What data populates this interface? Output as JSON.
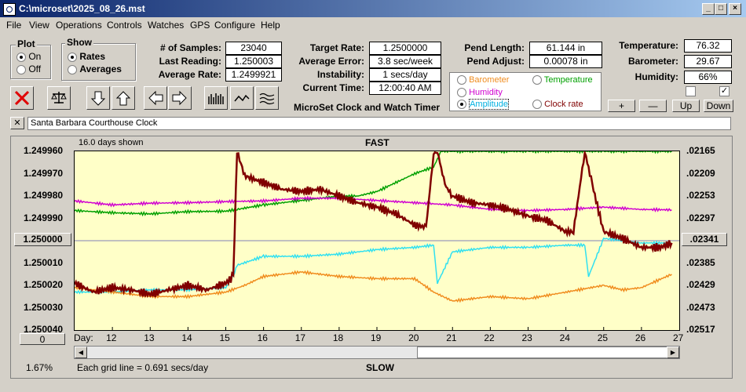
{
  "window": {
    "title": "C:\\microset\\2025_08_26.mst"
  },
  "menu": [
    "File",
    "View",
    "Operations",
    "Controls",
    "Watches",
    "GPS",
    "Configure",
    "Help"
  ],
  "plot_group": {
    "label": "Plot",
    "options": [
      "On",
      "Off"
    ],
    "selected": "On"
  },
  "show_group": {
    "label": "Show",
    "options": [
      "Rates",
      "Averages"
    ],
    "selected": "Rates"
  },
  "stats": {
    "samples_label": "# of Samples:",
    "samples": "23040",
    "last_label": "Last Reading:",
    "last": "1.250003",
    "avg_label": "Average Rate:",
    "avg": "1.2499921"
  },
  "rates": {
    "target_label": "Target Rate:",
    "target": "1.2500000",
    "error_label": "Average Error:",
    "error": "3.8 sec/week",
    "instab_label": "Instability:",
    "instab": "1 secs/day",
    "time_label": "Current Time:",
    "time": "12:00:40 AM"
  },
  "pend": {
    "length_label": "Pend Length:",
    "length": "61.144 in",
    "adjust_label": "Pend Adjust:",
    "adjust": "0.00078 in"
  },
  "sensor_options": {
    "items": [
      {
        "label": "Barometer",
        "color": "#f08c1e",
        "selected": false
      },
      {
        "label": "Temperature",
        "color": "#00a000",
        "selected": false
      },
      {
        "label": "Humidity",
        "color": "#d000d0",
        "selected": false
      },
      {
        "label": "Clock rate",
        "color": "#800000",
        "selected": false
      },
      {
        "label": "Amplitude",
        "color": "#00b0e0",
        "selected": true
      }
    ]
  },
  "env": {
    "temp_label": "Temperature:",
    "temp": "76.32",
    "baro_label": "Barometer:",
    "baro": "29.67",
    "hum_label": "Humidity:",
    "hum": "66%"
  },
  "scale_buttons": {
    "plus": "+",
    "minus": "—",
    "up": "Up",
    "down": "Down"
  },
  "app_caption": "MicroSet Clock and Watch Timer",
  "clock_name": "Santa Barbara Courthouse Clock",
  "close_x": "✕",
  "colors": {
    "rate": "#800000",
    "temperature": "#00a000",
    "humidity": "#d000d0",
    "amplitude": "#30e0f0",
    "barometer": "#f08c1e",
    "plot_bg": "#ffffc8"
  },
  "chart_data": {
    "type": "line",
    "title": "FAST",
    "bottom_label": "SLOW",
    "days_shown": "16.0 days shown",
    "grid_note": "Each grid line = 0.691 secs/day",
    "scroll_percent": "1.67%",
    "center_value": "1.250000",
    "right_center_value": ".02341",
    "left_button": "0",
    "x_prefix": "Day:",
    "x_ticks": [
      "12",
      "13",
      "14",
      "15",
      "16",
      "17",
      "18",
      "19",
      "20",
      "21",
      "22",
      "23",
      "24",
      "25",
      "26",
      "27"
    ],
    "xlim": [
      11,
      27
    ],
    "y_left_ticks": [
      "1.249960",
      "1.249970",
      "1.249980",
      "1.249990",
      "1.250000",
      "1.250010",
      "1.250020",
      "1.250030",
      "1.250040"
    ],
    "y_right_ticks": [
      ".02165",
      ".02209",
      ".02253",
      ".02297",
      ".02341",
      ".02385",
      ".02429",
      ".02473",
      ".02517"
    ],
    "ylim_left": [
      1.24996,
      1.25004
    ],
    "series": [
      {
        "key": "temperature",
        "x": [
          11,
          12,
          13,
          14,
          15,
          15.3,
          16,
          17,
          18,
          18.5,
          19,
          19.5,
          20,
          20.5,
          20.7,
          21,
          22,
          23,
          24,
          25,
          26,
          26.8
        ],
        "y": [
          1.2499865,
          1.2499875,
          1.249988,
          1.249987,
          1.2499868,
          1.249986,
          1.249984,
          1.249982,
          1.24998,
          1.24998,
          1.249978,
          1.249974,
          1.24997,
          1.249967,
          1.24996,
          1.24996,
          1.24996,
          1.24996,
          1.24996,
          1.24996,
          1.24996,
          1.24996
        ]
      },
      {
        "key": "humidity",
        "x": [
          11,
          12,
          13,
          14,
          15,
          16,
          17,
          18,
          19,
          20,
          21,
          22,
          23,
          24,
          25,
          26,
          26.8
        ],
        "y": [
          1.2499822,
          1.249984,
          1.2499832,
          1.249983,
          1.2499825,
          1.2499822,
          1.249981,
          1.249981,
          1.249982,
          1.249983,
          1.249984,
          1.249986,
          1.2499865,
          1.249986,
          1.249985,
          1.249986,
          1.2499862
        ]
      },
      {
        "key": "amplitude",
        "x": [
          11,
          12,
          13,
          14,
          15,
          15.2,
          15.3,
          16,
          17,
          18,
          19,
          20,
          20.5,
          20.6,
          21,
          22,
          23,
          24,
          24.5,
          24.6,
          25,
          26,
          26.8
        ],
        "y": [
          1.250023,
          1.250023,
          1.250022,
          1.250022,
          1.250021,
          1.250016,
          1.250011,
          1.250007,
          1.250007,
          1.250006,
          1.250004,
          1.250003,
          1.250002,
          1.250019,
          1.250005,
          1.250003,
          1.250003,
          1.250002,
          1.250002,
          1.250016,
          1.249999,
          1.250001,
          1.250001
        ]
      },
      {
        "key": "barometer",
        "x": [
          11,
          12,
          13,
          14,
          15,
          15.5,
          16,
          17,
          18,
          19,
          20,
          20.5,
          21,
          22,
          23,
          24,
          25,
          25.5,
          26,
          26.8
        ],
        "y": [
          1.250021,
          1.250023,
          1.250025,
          1.250025,
          1.250023,
          1.25002,
          1.250016,
          1.250014,
          1.250016,
          1.250017,
          1.250017,
          1.250023,
          1.250027,
          1.250025,
          1.250026,
          1.250023,
          1.25002,
          1.250022,
          1.250021,
          1.250015
        ]
      },
      {
        "key": "rate",
        "x": [
          11,
          11.5,
          12,
          12.5,
          13,
          13.5,
          14,
          14.5,
          15,
          15.2,
          15.3,
          15.5,
          16,
          16.5,
          17,
          17.5,
          18,
          18.5,
          19,
          19.5,
          20,
          20.3,
          20.5,
          20.6,
          20.8,
          21,
          21.5,
          22,
          22.5,
          23,
          23.5,
          24,
          24.2,
          24.5,
          24.7,
          25,
          25.5,
          26,
          26.5,
          26.8
        ],
        "y": [
          1.250019,
          1.250023,
          1.250021,
          1.250022,
          1.250024,
          1.250022,
          1.25002,
          1.250022,
          1.250019,
          1.250016,
          1.24996,
          1.249971,
          1.249974,
          1.249977,
          1.249978,
          1.249977,
          1.24998,
          1.249983,
          1.249985,
          1.249988,
          1.249993,
          1.249994,
          1.249961,
          1.24996,
          1.249975,
          1.24998,
          1.249983,
          1.249984,
          1.249986,
          1.249989,
          1.249991,
          1.249996,
          1.249996,
          1.24996,
          1.249975,
          1.249996,
          1.249999,
          1.250003,
          1.250003,
          1.250001
        ]
      }
    ]
  }
}
